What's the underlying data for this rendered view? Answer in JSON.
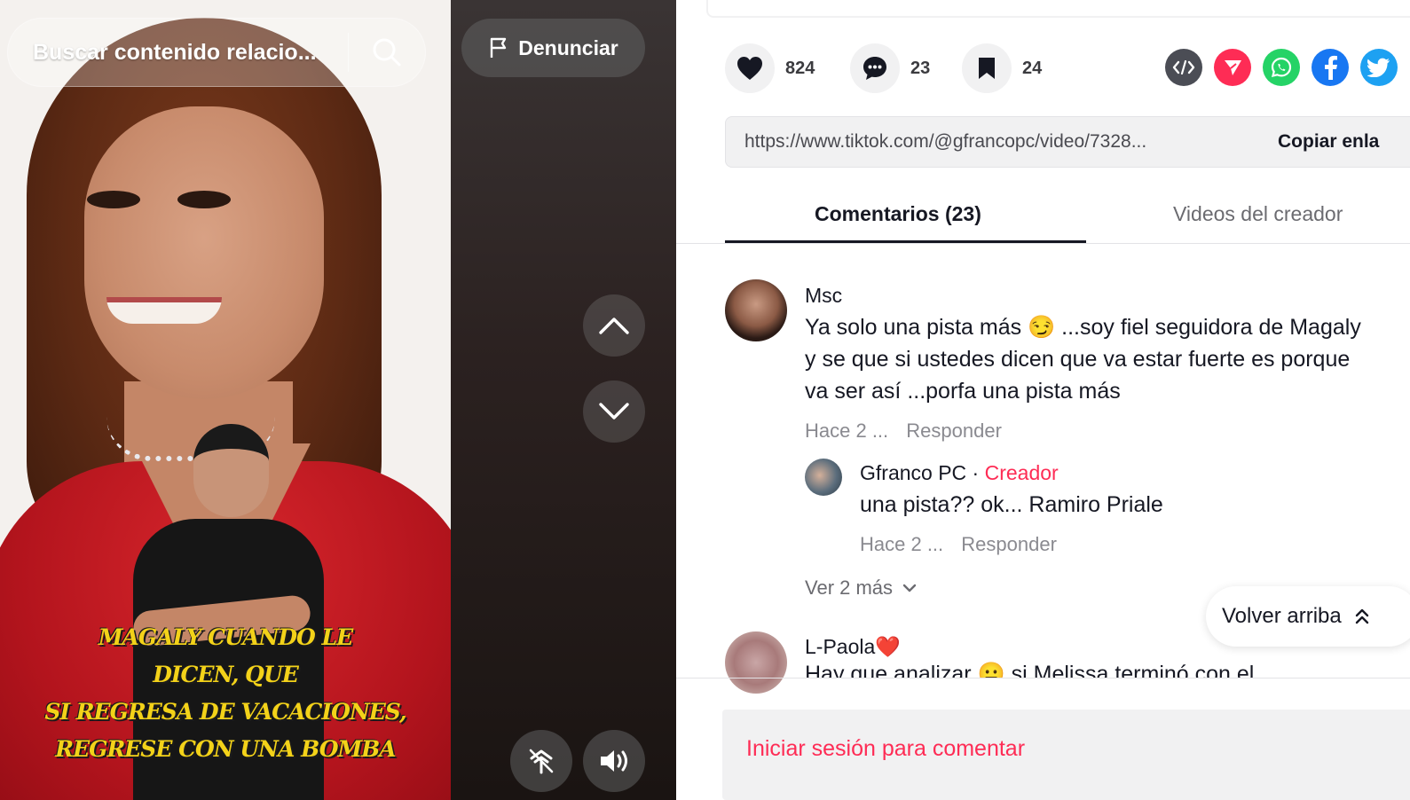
{
  "video": {
    "search_placeholder": "Buscar contenido relacio...",
    "report_label": "Denunciar",
    "caption_lines": [
      "MAGALY CUANDO LE",
      "DICEN, QUE",
      "SI REGRESA DE VACACIONES,",
      "REGRESE CON UNA BOMBA"
    ]
  },
  "actions": {
    "likes": "824",
    "comments": "23",
    "saves": "24"
  },
  "share_icons": [
    "embed-icon",
    "send-icon",
    "whatsapp-icon",
    "facebook-icon",
    "twitter-icon"
  ],
  "link": {
    "url": "https://www.tiktok.com/@gfrancopc/video/7328...",
    "copy_label": "Copiar enla"
  },
  "tabs": {
    "comments": "Comentarios (23)",
    "creator_videos": "Videos del creador"
  },
  "comments": [
    {
      "user": "Msc",
      "text": "Ya solo una pista más 😏 ...soy fiel seguidora de Magaly y se que si ustedes dicen que va estar fuerte es porque va ser así ...porfa una pista más",
      "time": "Hace 2 ...",
      "reply_label": "Responder",
      "reply": {
        "user": "Gfranco PC",
        "separator": " · ",
        "badge": "Creador",
        "text": "una pista?? ok... Ramiro Priale",
        "time": "Hace 2 ...",
        "reply_label": "Responder"
      },
      "more_label": "Ver 2 más"
    },
    {
      "user": "L-Paola❤️",
      "text": "Hay que analizar 😐 si Melissa terminó con el"
    }
  ],
  "back_to_top": "Volver arriba",
  "login_prompt": "Iniciar sesión para comentar",
  "colors": {
    "accent": "#fe2c55",
    "text_primary": "#161823",
    "text_secondary": "#8a8a90",
    "whatsapp": "#25d366",
    "facebook": "#1877f2",
    "twitter": "#1da1f2"
  }
}
